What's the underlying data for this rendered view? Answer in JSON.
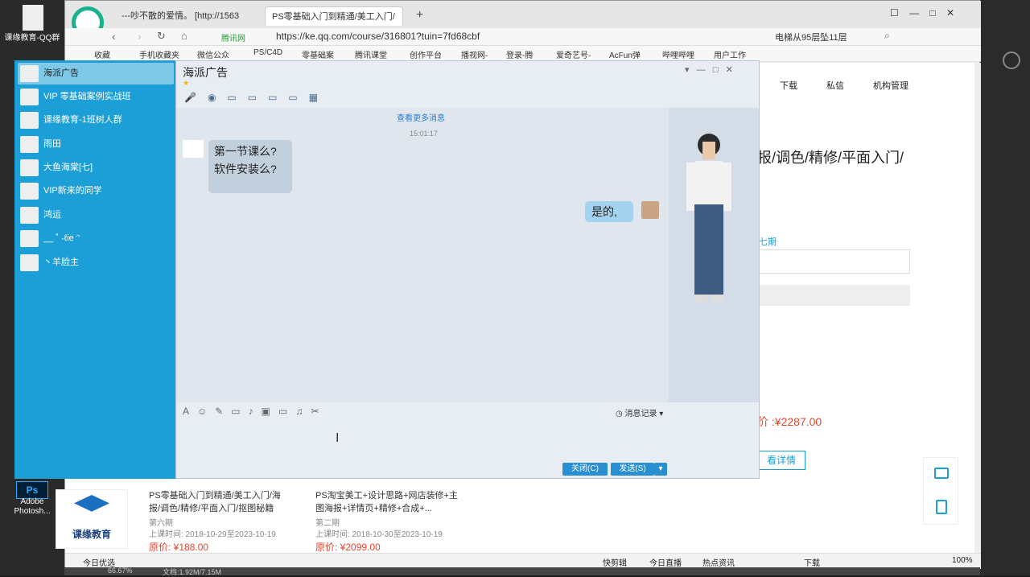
{
  "desktop": {
    "top_icon_label": "课缘教育-QQ群",
    "ps_icon_label": "Adobe Photosh...",
    "status_zoom": "66.67%",
    "status_doc": "文档:1.92M/7.15M"
  },
  "browser": {
    "tabs": [
      {
        "label": "---吵不散的爱情。 [http://1563"
      },
      {
        "label": "PS零基础入门到精通/美工入门/"
      }
    ],
    "url": "https://ke.qq.com/course/316801?tuin=7fd68cbf",
    "site_badge": "腾讯网",
    "search_hint": "电梯从95层坠11层",
    "bookmarks": [
      "收藏",
      "手机收藏夹",
      "微信公众",
      "PS/C4D",
      "零基础案",
      "腾讯课堂",
      "创作平台",
      "播视网-",
      "登录-腾",
      "爱奇艺号-",
      "AcFun弹",
      "哔哩哔哩",
      "用户工作"
    ],
    "status_items": [
      "今日优选",
      "快剪辑",
      "今日直播",
      "热点资讯",
      "下载",
      "100%"
    ],
    "page": {
      "nav": [
        "下载",
        "私信",
        "机构管理"
      ],
      "headline": "报/调色/精修/平面入门/",
      "tab_label": "七期",
      "price": "价 :¥2287.00",
      "detail_btn": "看详情",
      "cards": [
        {
          "title": "PS零基础入门到精通/美工入门/海报/调色/精修/平面入门/抠图秘籍",
          "period": "第六期",
          "time": "上课时间: 2018-10-29至2023-10-19",
          "price": "原价: ¥188.00"
        },
        {
          "title": "PS淘宝美工+设计思路+网店装修+主图海报+详情页+精修+合成+...",
          "period": "第二期",
          "time": "上课时间: 2018-10-30至2023-10-19",
          "price": "原价: ¥2099.00"
        }
      ],
      "logo_text": "课缘教育"
    }
  },
  "qq": {
    "contacts": [
      {
        "name": "海派广告",
        "selected": true
      },
      {
        "name": "VIP 零基础案例实战班"
      },
      {
        "name": "课缘教育-1班树人群"
      },
      {
        "name": "雨田"
      },
      {
        "name": "大鱼海棠[七]"
      },
      {
        "name": "VIP新来的同学"
      },
      {
        "name": "鸿运"
      },
      {
        "name": "__ ˚ ˖ℓie ᵔ"
      },
      {
        "name": "丶羊脸主"
      }
    ],
    "chat_title": "海派广告",
    "more_messages": "查看更多消息",
    "timestamp": "15:01:17",
    "msg_in_1": "第一节课么?",
    "msg_in_2": "软件安装么?",
    "msg_out": "是的,",
    "history": "消息记录",
    "close_btn": "关闭(C)",
    "send_btn": "发送(S)",
    "accent": "#1b9fd6"
  }
}
